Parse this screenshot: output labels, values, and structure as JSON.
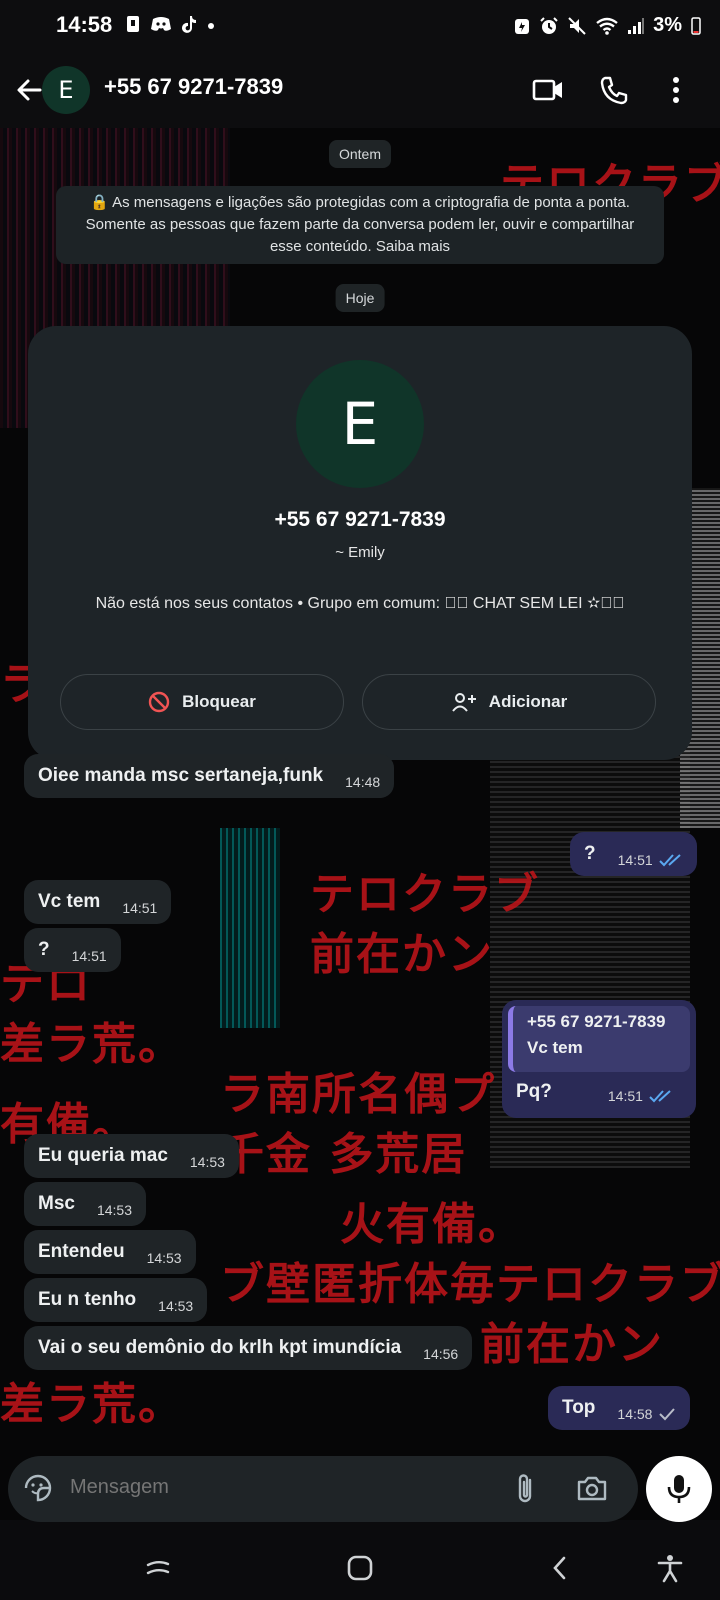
{
  "status_bar": {
    "time": "14:58",
    "battery": "3%",
    "icons_left": [
      "sim-icon",
      "discord-icon",
      "tiktok-icon",
      "dot-icon"
    ],
    "icons_right": [
      "battery-saver-icon",
      "alarm-icon",
      "mute-icon",
      "wifi-icon",
      "signal-icon",
      "battery-icon"
    ]
  },
  "header": {
    "avatar_letter": "E",
    "title": "+55 67 9271-7839"
  },
  "chat": {
    "date_yesterday": "Ontem",
    "encryption_notice": "🔒 As mensagens e ligações são protegidas com a criptografia de ponta a ponta. Somente as pessoas que fazem parte da conversa podem ler, ouvir e compartilhar esse conteúdo. Saiba mais",
    "date_today": "Hoje",
    "profile_card": {
      "avatar_letter": "E",
      "phone": "+55 67 9271-7839",
      "name": "~ Emily",
      "info": "Não está nos seus contatos • Grupo em comum: ✧⃝ CHAT SEM LEI ✫✧⃝",
      "block_label": "Bloquear",
      "add_label": "Adicionar"
    },
    "messages": [
      {
        "dir": "in",
        "text": "Oiee manda msc sertaneja,funk",
        "time": "14:48"
      },
      {
        "dir": "out",
        "text": "?",
        "time": "14:51",
        "status": "read"
      },
      {
        "dir": "in",
        "text": "Vc tem",
        "time": "14:51"
      },
      {
        "dir": "in",
        "text": "?",
        "time": "14:51"
      },
      {
        "dir": "out",
        "quoted_author": "+55 67 9271-7839",
        "quoted_text": "Vc tem",
        "text": "Pq?",
        "time": "14:51",
        "status": "read"
      },
      {
        "dir": "in",
        "text": "Eu queria mac",
        "time": "14:53"
      },
      {
        "dir": "in",
        "text": "Msc",
        "time": "14:53"
      },
      {
        "dir": "in",
        "text": "Entendeu",
        "time": "14:53"
      },
      {
        "dir": "in",
        "text": "Eu n tenho",
        "time": "14:53"
      },
      {
        "dir": "in",
        "text": "Vai o seu demônio do krlh kpt  imundícia",
        "time": "14:56"
      },
      {
        "dir": "out",
        "text": "Top",
        "time": "14:58",
        "status": "sent"
      }
    ]
  },
  "composer": {
    "placeholder": "Mensagem"
  },
  "colors": {
    "incoming_bubble": "#1f2427",
    "outgoing_bubble": "#2a2a56",
    "read_ticks": "#5aa8f0",
    "wallpaper_glyphs": "#c4151a",
    "block_icon": "#f05454"
  }
}
